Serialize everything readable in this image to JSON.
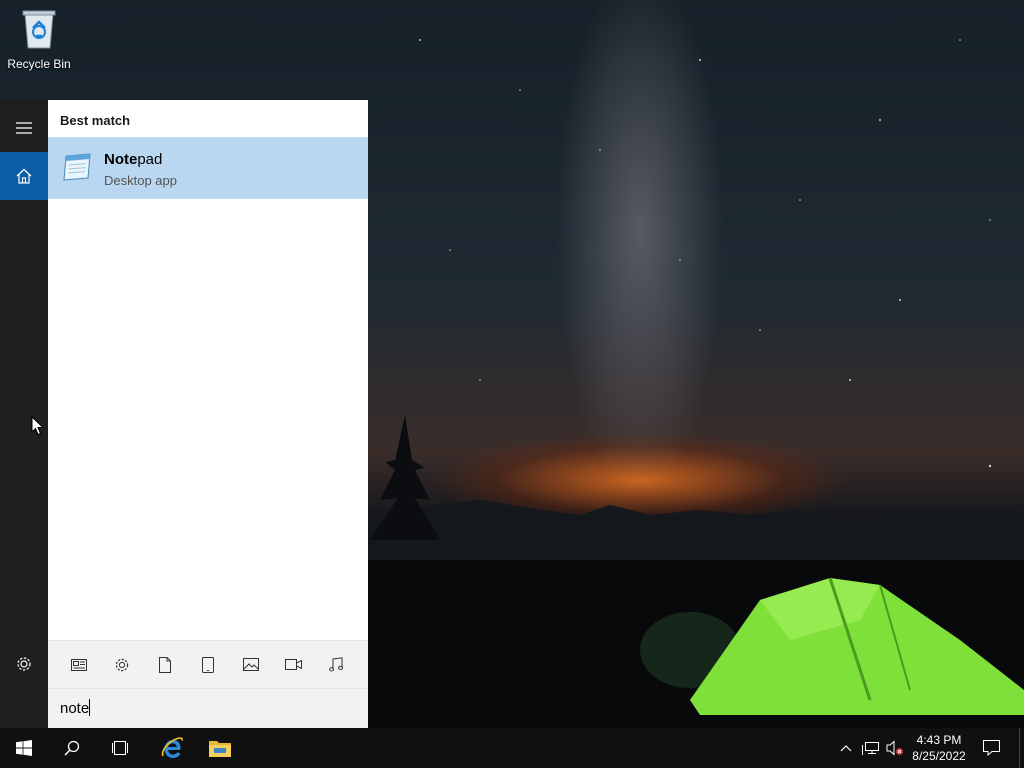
{
  "desktop": {
    "icons": [
      {
        "label": "Recycle Bin",
        "icon": "recycle-bin-icon"
      }
    ]
  },
  "start_menu": {
    "rail": [
      {
        "icon": "hamburger-menu-icon"
      },
      {
        "icon": "home-icon",
        "active": true
      },
      {
        "icon": "gear-icon"
      }
    ],
    "section_title": "Best match",
    "best_match": {
      "name_bold": "Note",
      "name_rest": "pad",
      "subtitle": "Desktop app",
      "icon": "notepad-icon"
    },
    "filters": [
      {
        "icon": "news-icon"
      },
      {
        "icon": "gear-icon"
      },
      {
        "icon": "document-icon"
      },
      {
        "icon": "tablet-icon"
      },
      {
        "icon": "image-icon"
      },
      {
        "icon": "video-icon"
      },
      {
        "icon": "music-icon"
      }
    ],
    "search_text": "note"
  },
  "taskbar": {
    "items": [
      {
        "icon": "windows-start-icon"
      },
      {
        "icon": "search-icon"
      },
      {
        "icon": "task-view-icon"
      },
      {
        "icon": "internet-explorer-icon"
      },
      {
        "icon": "file-explorer-icon"
      }
    ],
    "tray": [
      {
        "icon": "chevron-up-icon"
      },
      {
        "icon": "network-icon"
      },
      {
        "icon": "volume-muted-icon"
      }
    ],
    "time": "4:43 PM",
    "date": "8/25/2022",
    "action_center_icon": "notification-icon"
  },
  "colors": {
    "start_rail": "#1f1f1f",
    "selected_result": "#b9d7f0",
    "accent": "#0b5ea8",
    "taskbar": "#101010"
  }
}
